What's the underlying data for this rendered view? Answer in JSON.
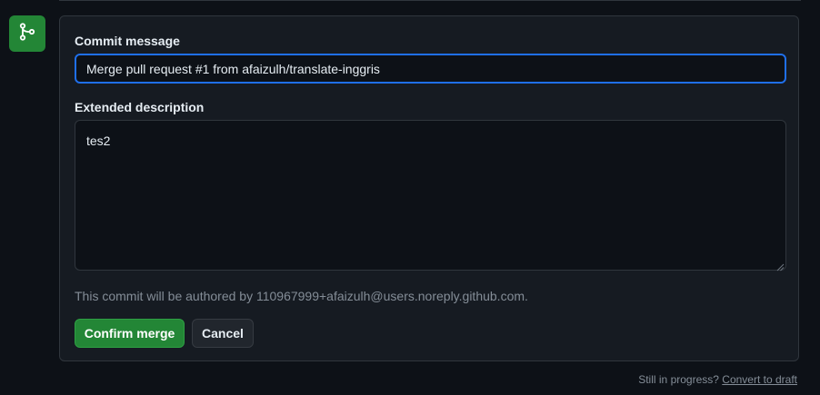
{
  "merge_form": {
    "commit_message_label": "Commit message",
    "commit_message_value": "Merge pull request #1 from afaizulh/translate-inggris",
    "extended_description_label": "Extended description",
    "extended_description_value": "tes2",
    "author_note": "This commit will be authored by 110967999+afaizulh@users.noreply.github.com.",
    "confirm_label": "Confirm merge",
    "cancel_label": "Cancel"
  },
  "footer": {
    "prompt": "Still in progress?",
    "link_label": "Convert to draft"
  },
  "icons": {
    "merge_icon": "git-merge-icon"
  },
  "colors": {
    "background": "#0d1117",
    "panel": "#161b22",
    "accent_green": "#238636",
    "focus_blue": "#1f6feb",
    "muted_text": "#848d97"
  }
}
